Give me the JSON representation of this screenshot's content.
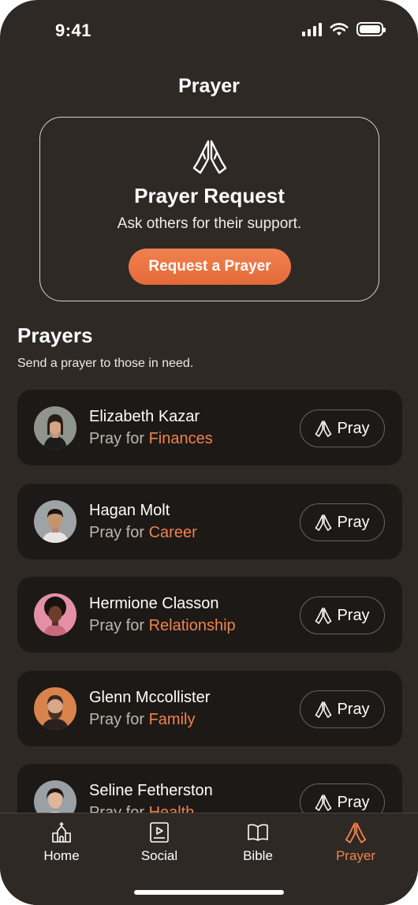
{
  "status": {
    "time": "9:41"
  },
  "page": {
    "title": "Prayer"
  },
  "request_card": {
    "icon": "praying-hands-icon",
    "title": "Prayer Request",
    "subtitle": "Ask others for their support.",
    "button_label": "Request a Prayer"
  },
  "prayers": {
    "title": "Prayers",
    "subtitle": "Send a prayer to those in need.",
    "pray_prefix": "Pray for",
    "button_label": "Pray",
    "items": [
      {
        "name": "Elizabeth Kazar",
        "category": "Finances"
      },
      {
        "name": "Hagan Molt",
        "category": "Career"
      },
      {
        "name": "Hermione Classon",
        "category": "Relationship"
      },
      {
        "name": "Glenn Mccollister",
        "category": "Family"
      },
      {
        "name": "Seline Fetherston",
        "category": "Health"
      }
    ]
  },
  "tabs": [
    {
      "label": "Home",
      "icon": "church-icon",
      "active": false
    },
    {
      "label": "Social",
      "icon": "video-post-icon",
      "active": false
    },
    {
      "label": "Bible",
      "icon": "open-book-icon",
      "active": false
    },
    {
      "label": "Prayer",
      "icon": "praying-hands-icon",
      "active": true
    }
  ],
  "colors": {
    "background": "#2e2925",
    "card": "#1d1916",
    "accent": "#f0834f"
  }
}
